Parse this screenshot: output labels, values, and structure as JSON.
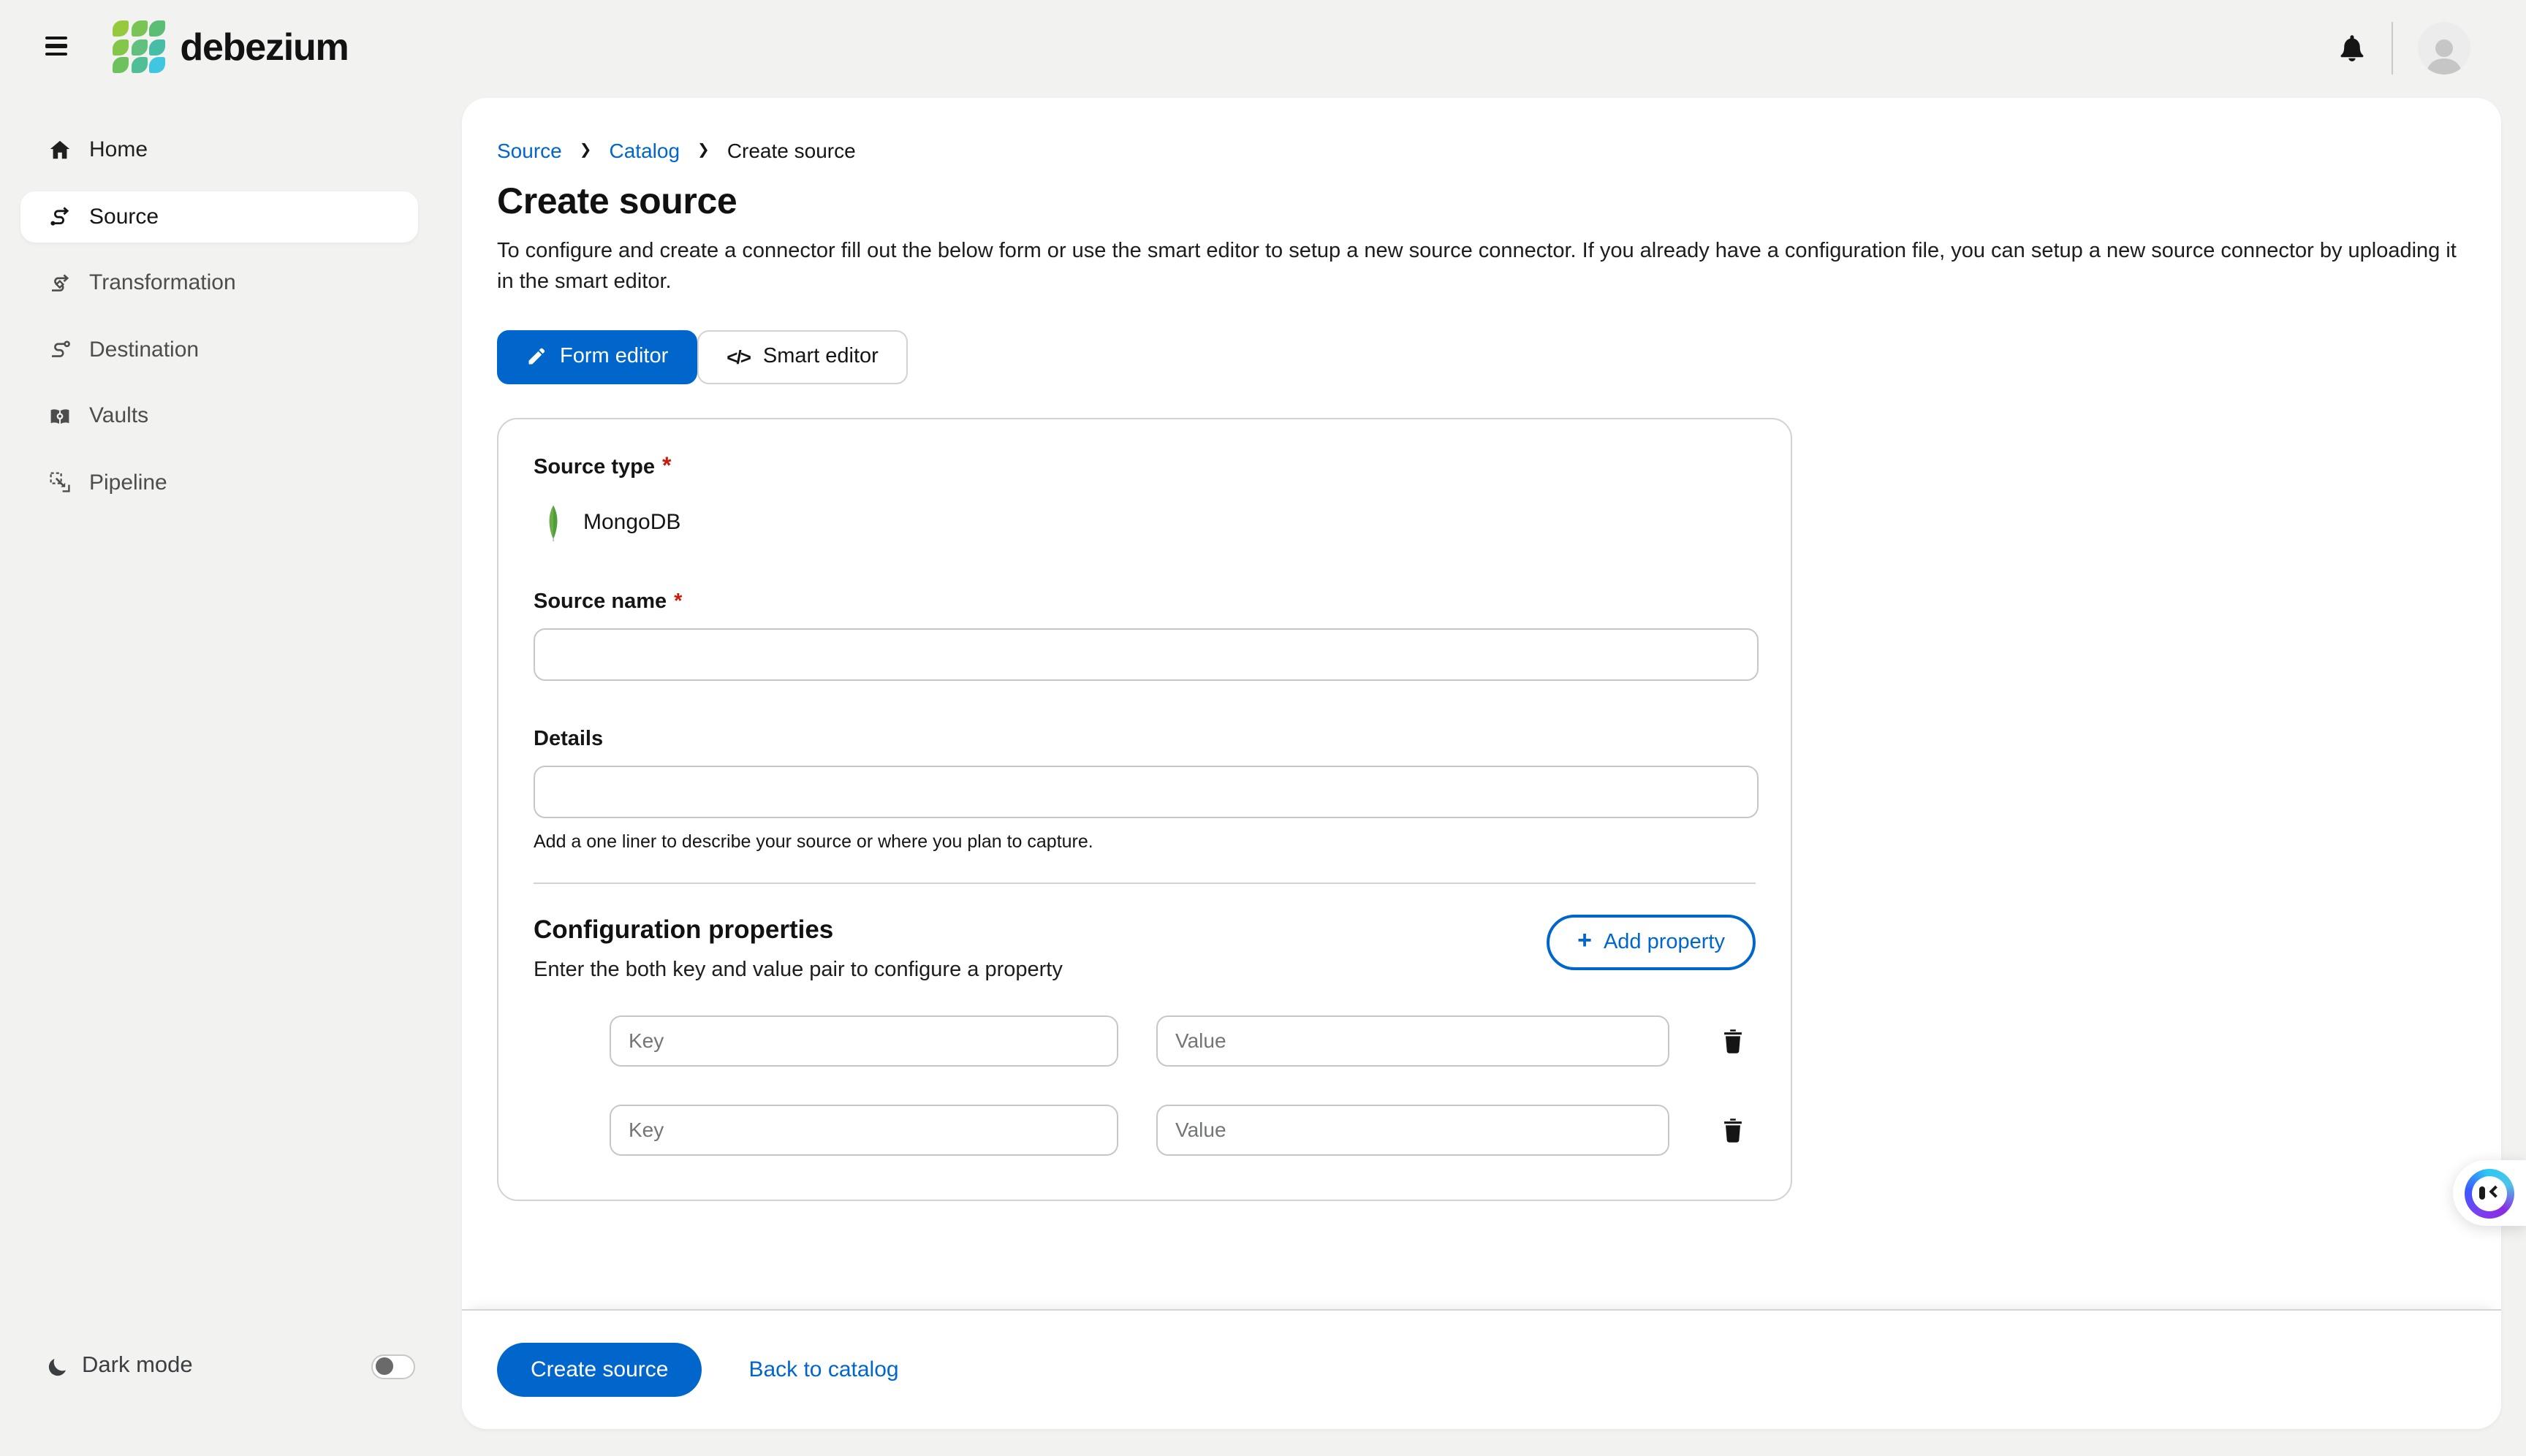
{
  "header": {
    "app_name": "debezium",
    "logo_tile_colors": [
      "#97c93d",
      "#7ac355",
      "#5cbe74",
      "#83c64a",
      "#62c07e",
      "#47bda6",
      "#6ec25e",
      "#50bf97",
      "#3fc6e0"
    ]
  },
  "sidebar": {
    "items": [
      {
        "label": "Home",
        "active": false
      },
      {
        "label": "Source",
        "active": true
      },
      {
        "label": "Transformation",
        "active": false
      },
      {
        "label": "Destination",
        "active": false
      },
      {
        "label": "Vaults",
        "active": false
      },
      {
        "label": "Pipeline",
        "active": false
      }
    ],
    "dark_mode_label": "Dark mode",
    "dark_mode_on": false
  },
  "breadcrumb": {
    "items": [
      {
        "label": "Source",
        "link": true
      },
      {
        "label": "Catalog",
        "link": true
      },
      {
        "label": "Create source",
        "link": false
      }
    ]
  },
  "page": {
    "title": "Create source",
    "description": "To configure and create a connector fill out the below form or use the smart editor to setup a new source connector. If you already have a configuration file, you can setup a new source connector by uploading it in the smart editor."
  },
  "tabs": [
    {
      "label": "Form editor",
      "active": true,
      "icon": "pencil-icon"
    },
    {
      "label": "Smart editor",
      "active": false,
      "icon": "code-icon",
      "icon_glyph": "</>"
    }
  ],
  "form": {
    "source_type": {
      "label": "Source type",
      "required": "*",
      "value": "MongoDB"
    },
    "source_name": {
      "label": "Source name",
      "required": "*",
      "value": ""
    },
    "details": {
      "label": "Details",
      "value": "",
      "helper": "Add a one liner to describe your source or where you plan to capture."
    },
    "config": {
      "title": "Configuration properties",
      "subtitle": "Enter the both key and value pair to configure a property",
      "add_button": "Add property",
      "rows": [
        {
          "key_placeholder": "Key",
          "value_placeholder": "Value",
          "key_value": "",
          "value_value": ""
        },
        {
          "key_placeholder": "Key",
          "value_placeholder": "Value",
          "key_value": "",
          "value_value": ""
        }
      ]
    }
  },
  "footer": {
    "create_button": "Create source",
    "back_link": "Back to catalog"
  },
  "colors": {
    "primary": "#0066cc",
    "link": "#0066cc",
    "danger": "#c9190b",
    "mongo_green_light": "#6cac48",
    "mongo_green_dark": "#4f9e3c"
  }
}
